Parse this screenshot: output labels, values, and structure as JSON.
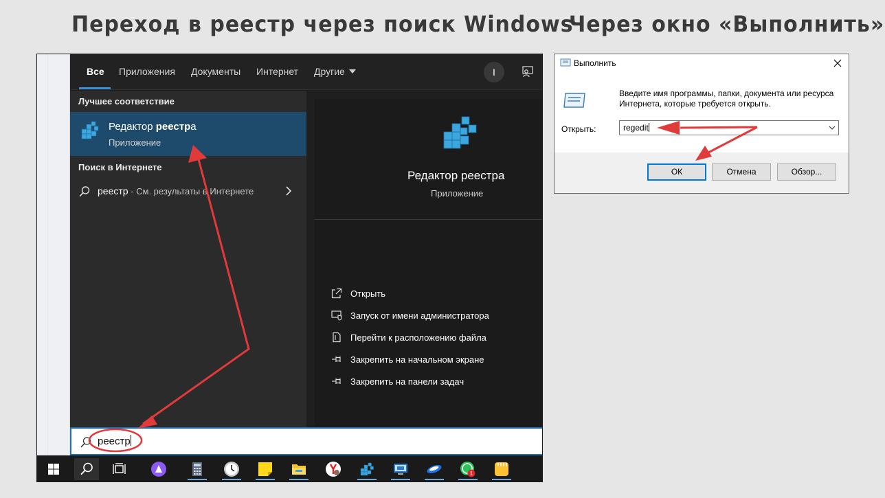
{
  "headings": {
    "left": "Переход в реестр через поиск Windows",
    "right": "Через окно «Выполнить»"
  },
  "search": {
    "tabs": [
      {
        "label": "Все",
        "active": true
      },
      {
        "label": "Приложения"
      },
      {
        "label": "Документы"
      },
      {
        "label": "Интернет"
      },
      {
        "label": "Другие"
      }
    ],
    "avatar_letter": "I",
    "best_match_header": "Лучшее соответствие",
    "best_match": {
      "title_prefix": "Редактор ",
      "title_bold": "реестр",
      "title_suffix": "а",
      "subtitle": "Приложение"
    },
    "web_header": "Поиск в Интернете",
    "web_result": {
      "query": "реестр",
      "suffix": " - См. результаты в Интернете"
    },
    "detail": {
      "title": "Редактор реестра",
      "subtitle": "Приложение",
      "actions": [
        {
          "label": "Открыть",
          "icon": "open-icon"
        },
        {
          "label": "Запуск от имени администратора",
          "icon": "shield-icon"
        },
        {
          "label": "Перейти к расположению файла",
          "icon": "file-location-icon"
        },
        {
          "label": "Закрепить на начальном экране",
          "icon": "pin-icon"
        },
        {
          "label": "Закрепить на панели задач",
          "icon": "pin-icon"
        }
      ]
    },
    "query": "реестр"
  },
  "taskbar": {
    "items": [
      "start-icon",
      "search-icon",
      "task-view-icon",
      "alice-icon",
      "calculator-icon",
      "clock-icon",
      "sticky-notes-icon",
      "file-explorer-icon",
      "yandex-browser-icon",
      "regedit-icon",
      "remote-desktop-icon",
      "app-icon",
      "whatsapp-icon",
      "notes-app-icon"
    ],
    "whatsapp_badge": "1"
  },
  "run_dialog": {
    "title": "Выполнить",
    "description": "Введите имя программы, папки, документа или ресурса Интернета, которые требуется открыть.",
    "open_label": "Открыть:",
    "input_value": "regedit",
    "ok_label": "ОК",
    "cancel_label": "Отмена",
    "browse_label": "Обзор..."
  },
  "colors": {
    "accent": "#3b8fd9",
    "highlight": "#1e4a6b",
    "annotation": "#e03a3a"
  }
}
